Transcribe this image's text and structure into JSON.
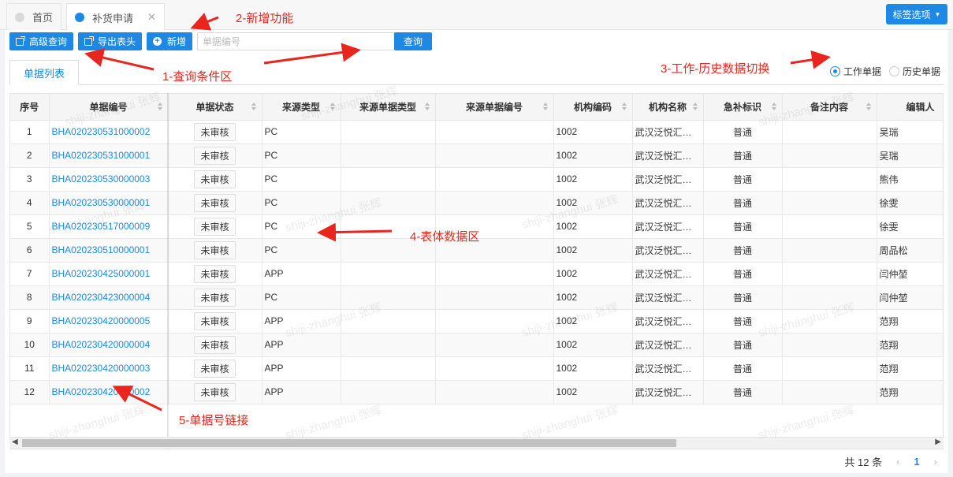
{
  "tabs": [
    {
      "label": "首页",
      "active": false
    },
    {
      "label": "补货申请",
      "active": true
    }
  ],
  "tag_options_label": "标签选项",
  "toolbar": {
    "advanced_query": "高级查询",
    "export_header": "导出表头",
    "add": "新增",
    "search_placeholder": "单据编号",
    "query": "查询"
  },
  "list_tab": "单据列表",
  "radios": [
    {
      "label": "工作单据",
      "checked": true
    },
    {
      "label": "历史单据",
      "checked": false
    }
  ],
  "table": {
    "columns": [
      "序号",
      "单据编号",
      "单据状态",
      "来源类型",
      "来源单据类型",
      "来源单据编号",
      "机构编码",
      "机构名称",
      "急补标识",
      "备注内容",
      "编辑人"
    ],
    "rows": [
      {
        "no": "1",
        "code": "BHA020230531000002",
        "status": "未审核",
        "source": "PC",
        "org_code": "1002",
        "org_name": "武汉泛悦汇购物中心",
        "urgent": "普通",
        "editor": "吴瑞"
      },
      {
        "no": "2",
        "code": "BHA020230531000001",
        "status": "未审核",
        "source": "PC",
        "org_code": "1002",
        "org_name": "武汉泛悦汇购物中心",
        "urgent": "普通",
        "editor": "吴瑞"
      },
      {
        "no": "3",
        "code": "BHA020230530000003",
        "status": "未审核",
        "source": "PC",
        "org_code": "1002",
        "org_name": "武汉泛悦汇购物中心",
        "urgent": "普通",
        "editor": "熊伟"
      },
      {
        "no": "4",
        "code": "BHA020230530000001",
        "status": "未审核",
        "source": "PC",
        "org_code": "1002",
        "org_name": "武汉泛悦汇购物中心",
        "urgent": "普通",
        "editor": "徐雯"
      },
      {
        "no": "5",
        "code": "BHA020230517000009",
        "status": "未审核",
        "source": "PC",
        "org_code": "1002",
        "org_name": "武汉泛悦汇购物中心",
        "urgent": "普通",
        "editor": "徐雯"
      },
      {
        "no": "6",
        "code": "BHA020230510000001",
        "status": "未审核",
        "source": "PC",
        "org_code": "1002",
        "org_name": "武汉泛悦汇购物中心",
        "urgent": "普通",
        "editor": "周品松"
      },
      {
        "no": "7",
        "code": "BHA020230425000001",
        "status": "未审核",
        "source": "APP",
        "org_code": "1002",
        "org_name": "武汉泛悦汇购物中心",
        "urgent": "普通",
        "editor": "闫仲堃"
      },
      {
        "no": "8",
        "code": "BHA020230423000004",
        "status": "未审核",
        "source": "PC",
        "org_code": "1002",
        "org_name": "武汉泛悦汇购物中心",
        "urgent": "普通",
        "editor": "闫仲堃"
      },
      {
        "no": "9",
        "code": "BHA020230420000005",
        "status": "未审核",
        "source": "APP",
        "org_code": "1002",
        "org_name": "武汉泛悦汇购物中心",
        "urgent": "普通",
        "editor": "范翔"
      },
      {
        "no": "10",
        "code": "BHA020230420000004",
        "status": "未审核",
        "source": "APP",
        "org_code": "1002",
        "org_name": "武汉泛悦汇购物中心",
        "urgent": "普通",
        "editor": "范翔"
      },
      {
        "no": "11",
        "code": "BHA020230420000003",
        "status": "未审核",
        "source": "APP",
        "org_code": "1002",
        "org_name": "武汉泛悦汇购物中心",
        "urgent": "普通",
        "editor": "范翔"
      },
      {
        "no": "12",
        "code": "BHA020230420000002",
        "status": "未审核",
        "source": "APP",
        "org_code": "1002",
        "org_name": "武汉泛悦汇购物中心",
        "urgent": "普通",
        "editor": "范翔"
      }
    ]
  },
  "pagination": {
    "total": "共 12 条",
    "current": "1"
  },
  "annotations": {
    "a1": "1-查询条件区",
    "a2": "2-新增功能",
    "a3": "3-工作-历史数据切换",
    "a4": "4-表体数据区",
    "a5": "5-单据号链接"
  },
  "watermark": "shiji-zhanghui 张辉",
  "colors": {
    "accent": "#1e88e5",
    "annotation": "#e8261e"
  }
}
